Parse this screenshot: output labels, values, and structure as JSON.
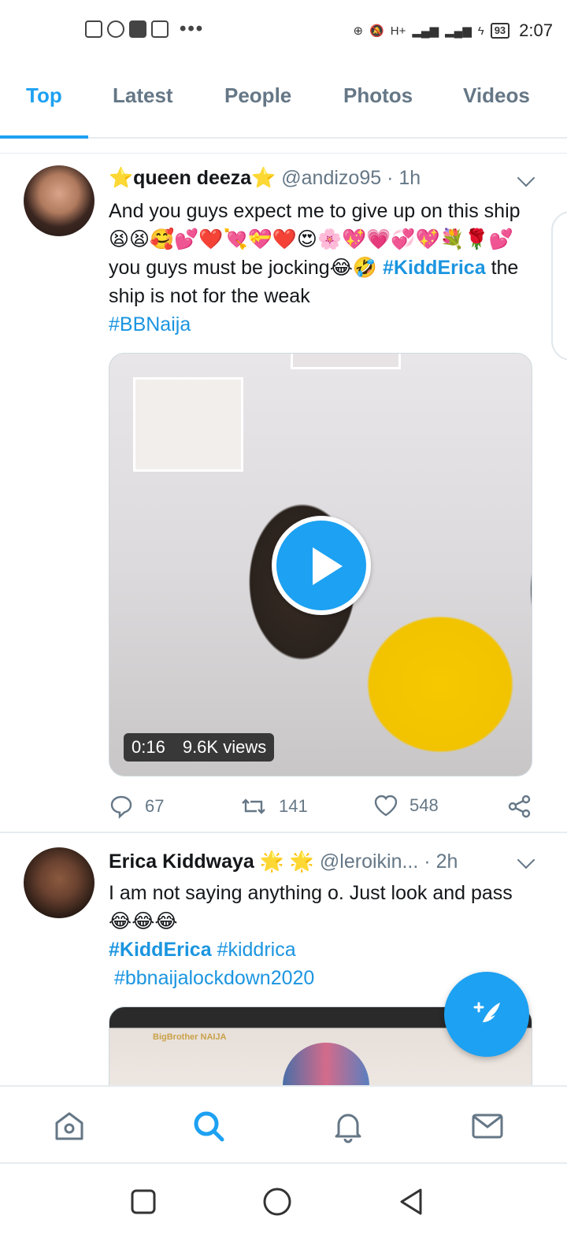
{
  "status_bar": {
    "battery": "93",
    "time": "2:07",
    "network": "H+"
  },
  "tabs": [
    {
      "label": "Top",
      "active": true
    },
    {
      "label": "Latest",
      "active": false
    },
    {
      "label": "People",
      "active": false
    },
    {
      "label": "Photos",
      "active": false
    },
    {
      "label": "Videos",
      "active": false
    }
  ],
  "tweets": [
    {
      "name": "⭐queen deeza⭐",
      "handle": "@andizo95",
      "sep": "·",
      "time": "1h",
      "text_line1": "And you guys expect me to give up on this ship 😫😫🥰💕❤️💘💝❤️😍🌸💖💗💞💖💐🌹💕you guys must be jocking😂🤣",
      "hashtag1": "#KiddErica",
      "text_after": "the ship is not for the weak",
      "hashtag2": "#BBNaija",
      "video_duration": "0:16",
      "video_views": "9.6K views",
      "replies": "67",
      "retweets": "141",
      "likes": "548"
    },
    {
      "name": "Erica Kiddwaya 🌟 🌟",
      "handle": "@leroikin...",
      "sep": "·",
      "time": "2h",
      "text_line1": "I am not saying anything o. Just look and pass 😂😂😂",
      "hashtag1": "#KiddErica",
      "hashtag2": "#kiddrica",
      "hashtag3": "#bbnaijalockdown2020",
      "media_logo": "BigBrother NAIJA"
    }
  ],
  "colors": {
    "accent": "#1da1f2",
    "text": "#14171a",
    "muted": "#657786"
  },
  "icons": [
    "home-icon",
    "search-icon",
    "notifications-icon",
    "messages-icon",
    "compose-icon",
    "reply-icon",
    "retweet-icon",
    "like-icon",
    "share-icon",
    "chevron-down-icon",
    "play-icon"
  ]
}
